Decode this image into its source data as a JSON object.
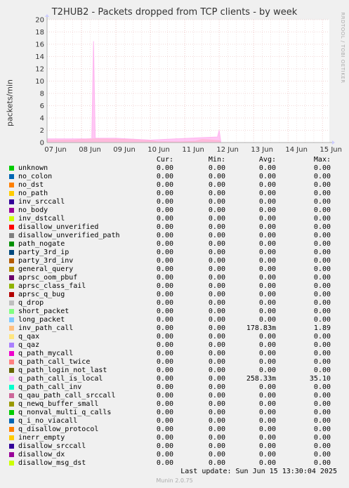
{
  "chart_data": {
    "type": "area",
    "title": "T2HUB2 - Packets dropped from TCP clients - by week",
    "ylabel": "packets/min",
    "ylim": [
      0,
      20
    ],
    "yticks": [
      0,
      2,
      4,
      6,
      8,
      10,
      12,
      14,
      16,
      18,
      20
    ],
    "xticks": [
      "07 Jun",
      "08 Jun",
      "09 Jun",
      "10 Jun",
      "11 Jun",
      "12 Jun",
      "13 Jun",
      "14 Jun",
      "15 Jun"
    ],
    "xlim": [
      0,
      8.2
    ],
    "grid": true,
    "series": [
      {
        "name": "inv_path_call",
        "color": "#ffbe7d",
        "x": [
          0,
          0.8,
          1.2,
          2.0,
          2.8,
          3.2,
          3.8,
          4.3,
          4.5,
          4.8,
          5.0,
          5.05,
          8.2
        ],
        "y": [
          0.35,
          0.4,
          0.6,
          0.55,
          0.45,
          0.15,
          0.1,
          0.2,
          0.5,
          0.4,
          0.3,
          0,
          0
        ]
      },
      {
        "name": "q_path_call_is_local",
        "color": "#ffb4f0",
        "x": [
          0,
          1.3,
          1.35,
          1.4,
          2.0,
          3.0,
          4.5,
          4.95,
          5.0,
          5.05,
          8.2
        ],
        "y": [
          0.6,
          0.6,
          16.5,
          0.7,
          0.7,
          0.4,
          0.8,
          0.9,
          2.0,
          0,
          0
        ]
      }
    ]
  },
  "legend": {
    "headers": {
      "cur": "Cur:",
      "min": "Min:",
      "avg": "Avg:",
      "max": "Max:"
    },
    "rows": [
      {
        "name": "unknown",
        "color": "#00cc00",
        "cur": "0.00",
        "min": "0.00",
        "avg": "0.00",
        "max": "0.00"
      },
      {
        "name": "no_colon",
        "color": "#0066b3",
        "cur": "0.00",
        "min": "0.00",
        "avg": "0.00",
        "max": "0.00"
      },
      {
        "name": "no_dst",
        "color": "#ff8000",
        "cur": "0.00",
        "min": "0.00",
        "avg": "0.00",
        "max": "0.00"
      },
      {
        "name": "no_path",
        "color": "#ffcc00",
        "cur": "0.00",
        "min": "0.00",
        "avg": "0.00",
        "max": "0.00"
      },
      {
        "name": "inv_srccall",
        "color": "#330099",
        "cur": "0.00",
        "min": "0.00",
        "avg": "0.00",
        "max": "0.00"
      },
      {
        "name": "no_body",
        "color": "#990099",
        "cur": "0.00",
        "min": "0.00",
        "avg": "0.00",
        "max": "0.00"
      },
      {
        "name": "inv_dstcall",
        "color": "#ccff00",
        "cur": "0.00",
        "min": "0.00",
        "avg": "0.00",
        "max": "0.00"
      },
      {
        "name": "disallow_unverified",
        "color": "#ff0000",
        "cur": "0.00",
        "min": "0.00",
        "avg": "0.00",
        "max": "0.00"
      },
      {
        "name": "disallow_unverified_path",
        "color": "#808080",
        "cur": "0.00",
        "min": "0.00",
        "avg": "0.00",
        "max": "0.00"
      },
      {
        "name": "path_nogate",
        "color": "#008f00",
        "cur": "0.00",
        "min": "0.00",
        "avg": "0.00",
        "max": "0.00"
      },
      {
        "name": "party_3rd_ip",
        "color": "#00487d",
        "cur": "0.00",
        "min": "0.00",
        "avg": "0.00",
        "max": "0.00"
      },
      {
        "name": "party_3rd_inv",
        "color": "#b35a00",
        "cur": "0.00",
        "min": "0.00",
        "avg": "0.00",
        "max": "0.00"
      },
      {
        "name": "general_query",
        "color": "#b38f00",
        "cur": "0.00",
        "min": "0.00",
        "avg": "0.00",
        "max": "0.00"
      },
      {
        "name": "aprsc_oom_pbuf",
        "color": "#6b006b",
        "cur": "0.00",
        "min": "0.00",
        "avg": "0.00",
        "max": "0.00"
      },
      {
        "name": "aprsc_class_fail",
        "color": "#8fb300",
        "cur": "0.00",
        "min": "0.00",
        "avg": "0.00",
        "max": "0.00"
      },
      {
        "name": "aprsc_q_bug",
        "color": "#b30000",
        "cur": "0.00",
        "min": "0.00",
        "avg": "0.00",
        "max": "0.00"
      },
      {
        "name": "q_drop",
        "color": "#bebebe",
        "cur": "0.00",
        "min": "0.00",
        "avg": "0.00",
        "max": "0.00"
      },
      {
        "name": "short_packet",
        "color": "#80ff80",
        "cur": "0.00",
        "min": "0.00",
        "avg": "0.00",
        "max": "0.00"
      },
      {
        "name": "long_packet",
        "color": "#80c9ff",
        "cur": "0.00",
        "min": "0.00",
        "avg": "0.00",
        "max": "0.00"
      },
      {
        "name": "inv_path_call",
        "color": "#ffc080",
        "cur": "0.00",
        "min": "0.00",
        "avg": "178.83m",
        "max": "1.89"
      },
      {
        "name": "q_qax",
        "color": "#ffe680",
        "cur": "0.00",
        "min": "0.00",
        "avg": "0.00",
        "max": "0.00"
      },
      {
        "name": "q_qaz",
        "color": "#aa80ff",
        "cur": "0.00",
        "min": "0.00",
        "avg": "0.00",
        "max": "0.00"
      },
      {
        "name": "q_path_mycall",
        "color": "#ee00cc",
        "cur": "0.00",
        "min": "0.00",
        "avg": "0.00",
        "max": "0.00"
      },
      {
        "name": "q_path_call_twice",
        "color": "#ff8080",
        "cur": "0.00",
        "min": "0.00",
        "avg": "0.00",
        "max": "0.00"
      },
      {
        "name": "q_path_login_not_last",
        "color": "#666600",
        "cur": "0.00",
        "min": "0.00",
        "avg": "0.00",
        "max": "0.00"
      },
      {
        "name": "q_path_call_is_local",
        "color": "#ffbfff",
        "cur": "0.00",
        "min": "0.00",
        "avg": "258.33m",
        "max": "35.10"
      },
      {
        "name": "q_path_call_inv",
        "color": "#00ffcc",
        "cur": "0.00",
        "min": "0.00",
        "avg": "0.00",
        "max": "0.00"
      },
      {
        "name": "q_qau_path_call_srccall",
        "color": "#cc6699",
        "cur": "0.00",
        "min": "0.00",
        "avg": "0.00",
        "max": "0.00"
      },
      {
        "name": "q_newq_buffer_small",
        "color": "#999900",
        "cur": "0.00",
        "min": "0.00",
        "avg": "0.00",
        "max": "0.00"
      },
      {
        "name": "q_nonval_multi_q_calls",
        "color": "#00cc00",
        "cur": "0.00",
        "min": "0.00",
        "avg": "0.00",
        "max": "0.00"
      },
      {
        "name": "q_i_no_viacall",
        "color": "#0066b3",
        "cur": "0.00",
        "min": "0.00",
        "avg": "0.00",
        "max": "0.00"
      },
      {
        "name": "q_disallow_protocol",
        "color": "#ff8000",
        "cur": "0.00",
        "min": "0.00",
        "avg": "0.00",
        "max": "0.00"
      },
      {
        "name": "inerr_empty",
        "color": "#ffcc00",
        "cur": "0.00",
        "min": "0.00",
        "avg": "0.00",
        "max": "0.00"
      },
      {
        "name": "disallow_srccall",
        "color": "#330099",
        "cur": "0.00",
        "min": "0.00",
        "avg": "0.00",
        "max": "0.00"
      },
      {
        "name": "disallow_dx",
        "color": "#990099",
        "cur": "0.00",
        "min": "0.00",
        "avg": "0.00",
        "max": "0.00"
      },
      {
        "name": "disallow_msg_dst",
        "color": "#ccff00",
        "cur": "0.00",
        "min": "0.00",
        "avg": "0.00",
        "max": "0.00"
      }
    ]
  },
  "side_text": "RRDTOOL / TOBI OETIKER",
  "last_update": "Last update: Sun Jun 15 13:30:04 2025",
  "footer": "Munin 2.0.75"
}
